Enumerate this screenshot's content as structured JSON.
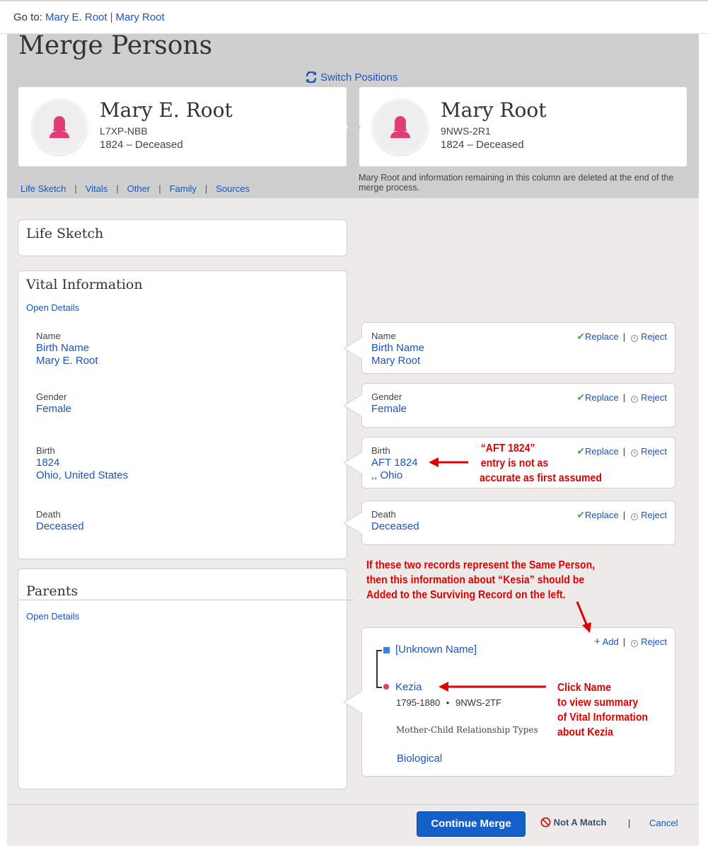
{
  "topbar": {
    "prefix": "Go to:",
    "link1": "Mary E. Root",
    "separator": "|",
    "link2": "Mary Root"
  },
  "header": {
    "title": "Merge Persons",
    "switch_label": "Switch Positions"
  },
  "survivor": {
    "name": "Mary E. Root",
    "id": "L7XP-NBB",
    "lifespan": "1824 – Deceased"
  },
  "duplicate": {
    "name": "Mary Root",
    "id": "9NWS-2R1",
    "lifespan": "1824 – Deceased"
  },
  "nav": {
    "items": [
      "Life Sketch",
      "Vitals",
      "Other",
      "Family",
      "Sources"
    ],
    "separator": "|"
  },
  "delete_note": "Mary Root and information remaining in this column are deleted at the end of the merge process.",
  "life_sketch": {
    "title": "Life Sketch"
  },
  "vital": {
    "title": "Vital Information",
    "open_details": "Open Details",
    "left": {
      "name_label": "Name",
      "name_type": "Birth Name",
      "name_value": "Mary E. Root",
      "gender_label": "Gender",
      "gender_value": "Female",
      "birth_label": "Birth",
      "birth_date": "1824",
      "birth_place": "Ohio, United States",
      "death_label": "Death",
      "death_value": "Deceased"
    },
    "right": {
      "name_label": "Name",
      "name_type": "Birth Name",
      "name_value": "Mary Root",
      "gender_label": "Gender",
      "gender_value": "Female",
      "birth_label": "Birth",
      "birth_date": "AFT 1824",
      "birth_place": ",, Ohio",
      "death_label": "Death",
      "death_value": "Deceased"
    }
  },
  "actions": {
    "replace": "Replace",
    "reject": "Reject",
    "add": "Add",
    "bar": "|",
    "check": "✔",
    "plus": "+"
  },
  "parents": {
    "title": "Parents",
    "open_details": "Open Details",
    "father": "[Unknown Name]",
    "mother": "Kezia",
    "mother_dates": "1795-1880",
    "dot": "•",
    "mother_id": "9NWS-2TF",
    "rel_label": "Mother-Child Relationship Types",
    "rel_value": "Biological"
  },
  "annotations": {
    "aft": [
      "“AFT 1824”",
      "entry is not as",
      "accurate as first assumed"
    ],
    "same_person": [
      "If these two records represent the Same Person,",
      "then this information about “Kesia” should be",
      "Added to the Surviving Record on the left."
    ],
    "click_name": [
      "Click Name",
      "to view summary",
      "of Vital Information",
      "about Kezia"
    ]
  },
  "footer": {
    "continue": "Continue Merge",
    "not_match": "Not A Match",
    "bar": "|",
    "cancel": "Cancel"
  },
  "colors": {
    "link": "#1a56b8",
    "primary": "#1560c8",
    "annotation": "#e00000",
    "avatar": "#e03c78"
  }
}
